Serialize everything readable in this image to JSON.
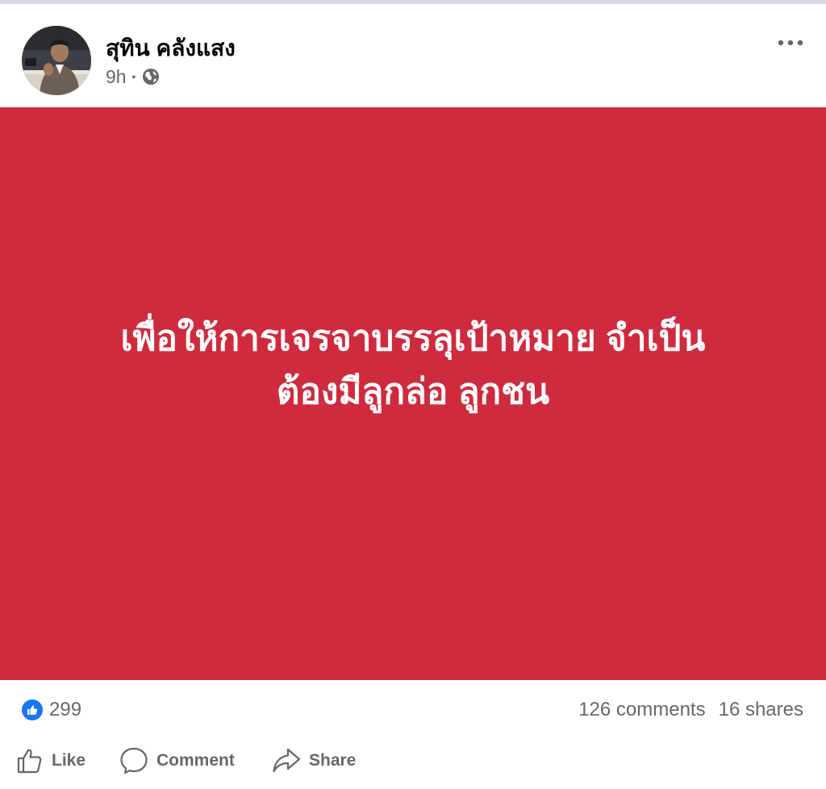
{
  "post": {
    "author": "สุทิน คลังแสง",
    "time": "9h",
    "separator": "·",
    "privacy_icon": "globe-icon",
    "more_icon": "more-icon",
    "background_color": "#ce2b3f",
    "text_lines": [
      "เพื่อให้การเจรจาบรรลุเป้าหมาย จำเป็น",
      "ต้องมีลูกล่อ ลูกชน"
    ]
  },
  "stats": {
    "reaction_icon": "like-reaction-icon",
    "reaction_count": "299",
    "comments": "126 comments",
    "shares": "16 shares"
  },
  "actions": {
    "like": "Like",
    "comment": "Comment",
    "share": "Share"
  },
  "colors": {
    "accent": "#1877f2",
    "secondary_text": "#65676b",
    "primary_text": "#050505"
  }
}
